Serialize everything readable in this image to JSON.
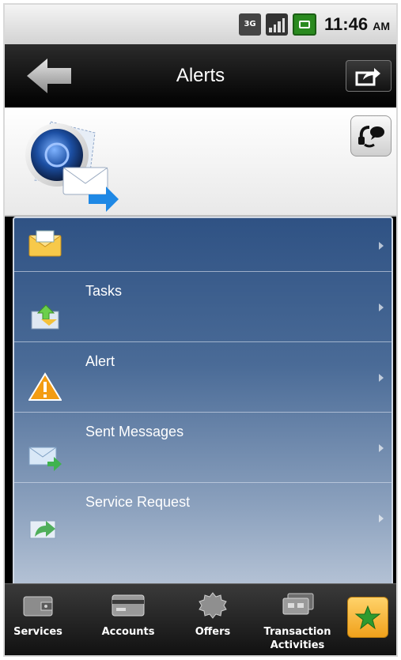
{
  "status_bar": {
    "network": "3G",
    "time": "11:46",
    "ampm": "AM"
  },
  "header": {
    "title": "Alerts"
  },
  "alerts_list": [
    {
      "label": "",
      "icon": "envelope-icon"
    },
    {
      "label": "Tasks",
      "icon": "tasks-icon"
    },
    {
      "label": "Alert",
      "icon": "warning-icon"
    },
    {
      "label": "Sent Messages",
      "icon": "sent-messages-icon"
    },
    {
      "label": "Service Request",
      "icon": "service-request-icon"
    }
  ],
  "bottom_nav": {
    "tabs": [
      {
        "label": "Services",
        "icon": "wallet-icon"
      },
      {
        "label": "Accounts",
        "icon": "card-icon"
      },
      {
        "label": "Offers",
        "icon": "badge-icon"
      },
      {
        "label": "Transaction Activities",
        "icon": "transactions-icon"
      }
    ],
    "favorite_icon": "star-icon"
  },
  "colors": {
    "list_top": "#2f5284",
    "list_bottom": "#b4c2d5",
    "warning": "#f39c12",
    "favorite": "#f0a11b"
  }
}
